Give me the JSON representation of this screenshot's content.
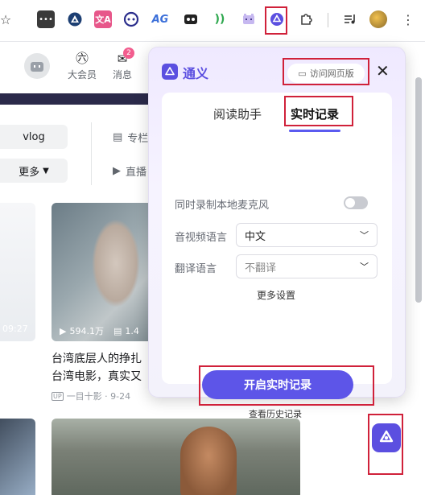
{
  "toolbar": {
    "icons": [
      "star-icon",
      "dots-extension-icon",
      "vpn-triangle-icon",
      "translate-icon",
      "bilibili-face-icon",
      "ag-icon",
      "game-icon",
      "signal-icon",
      "pixel-cat-icon",
      "tongyi-extension-icon",
      "puzzle-icon",
      "media-control-icon",
      "profile-avatar",
      "menu-dots-icon"
    ],
    "ag_text": "AG",
    "signal_text": "))"
  },
  "page": {
    "vip_label": "大会员",
    "message_label": "消息",
    "message_badge": "2",
    "category_vlog": "vlog",
    "more_label": "更多",
    "nav_column": "专栏",
    "nav_live": "直播",
    "left_card_duration": "09:27",
    "card1_views": "594.1万",
    "card1_danmaku": "1.4",
    "card1_title_line1": "台湾底层人的挣扎",
    "card1_title_line2": "台湾电影，真实又",
    "card1_up_badge": "UP",
    "card1_up_name": "一目十影 · 9-24"
  },
  "popup": {
    "brand": "通义",
    "visit_web_label": "访问网页版",
    "tabs": [
      {
        "label": "阅读助手",
        "active": false
      },
      {
        "label": "实时记录",
        "active": true
      }
    ],
    "record_mic_label": "同时录制本地麦克风",
    "record_mic_on": false,
    "audio_lang_label": "音视频语言",
    "audio_lang_value": "中文",
    "translate_lang_label": "翻译语言",
    "translate_lang_placeholder": "不翻译",
    "more_settings": "更多设置",
    "start_button": "开启实时记录",
    "history_link": "查看历史记录"
  },
  "colors": {
    "accent": "#5d55e8",
    "highlight": "#d0213a",
    "brand": "#5b4fe0"
  }
}
